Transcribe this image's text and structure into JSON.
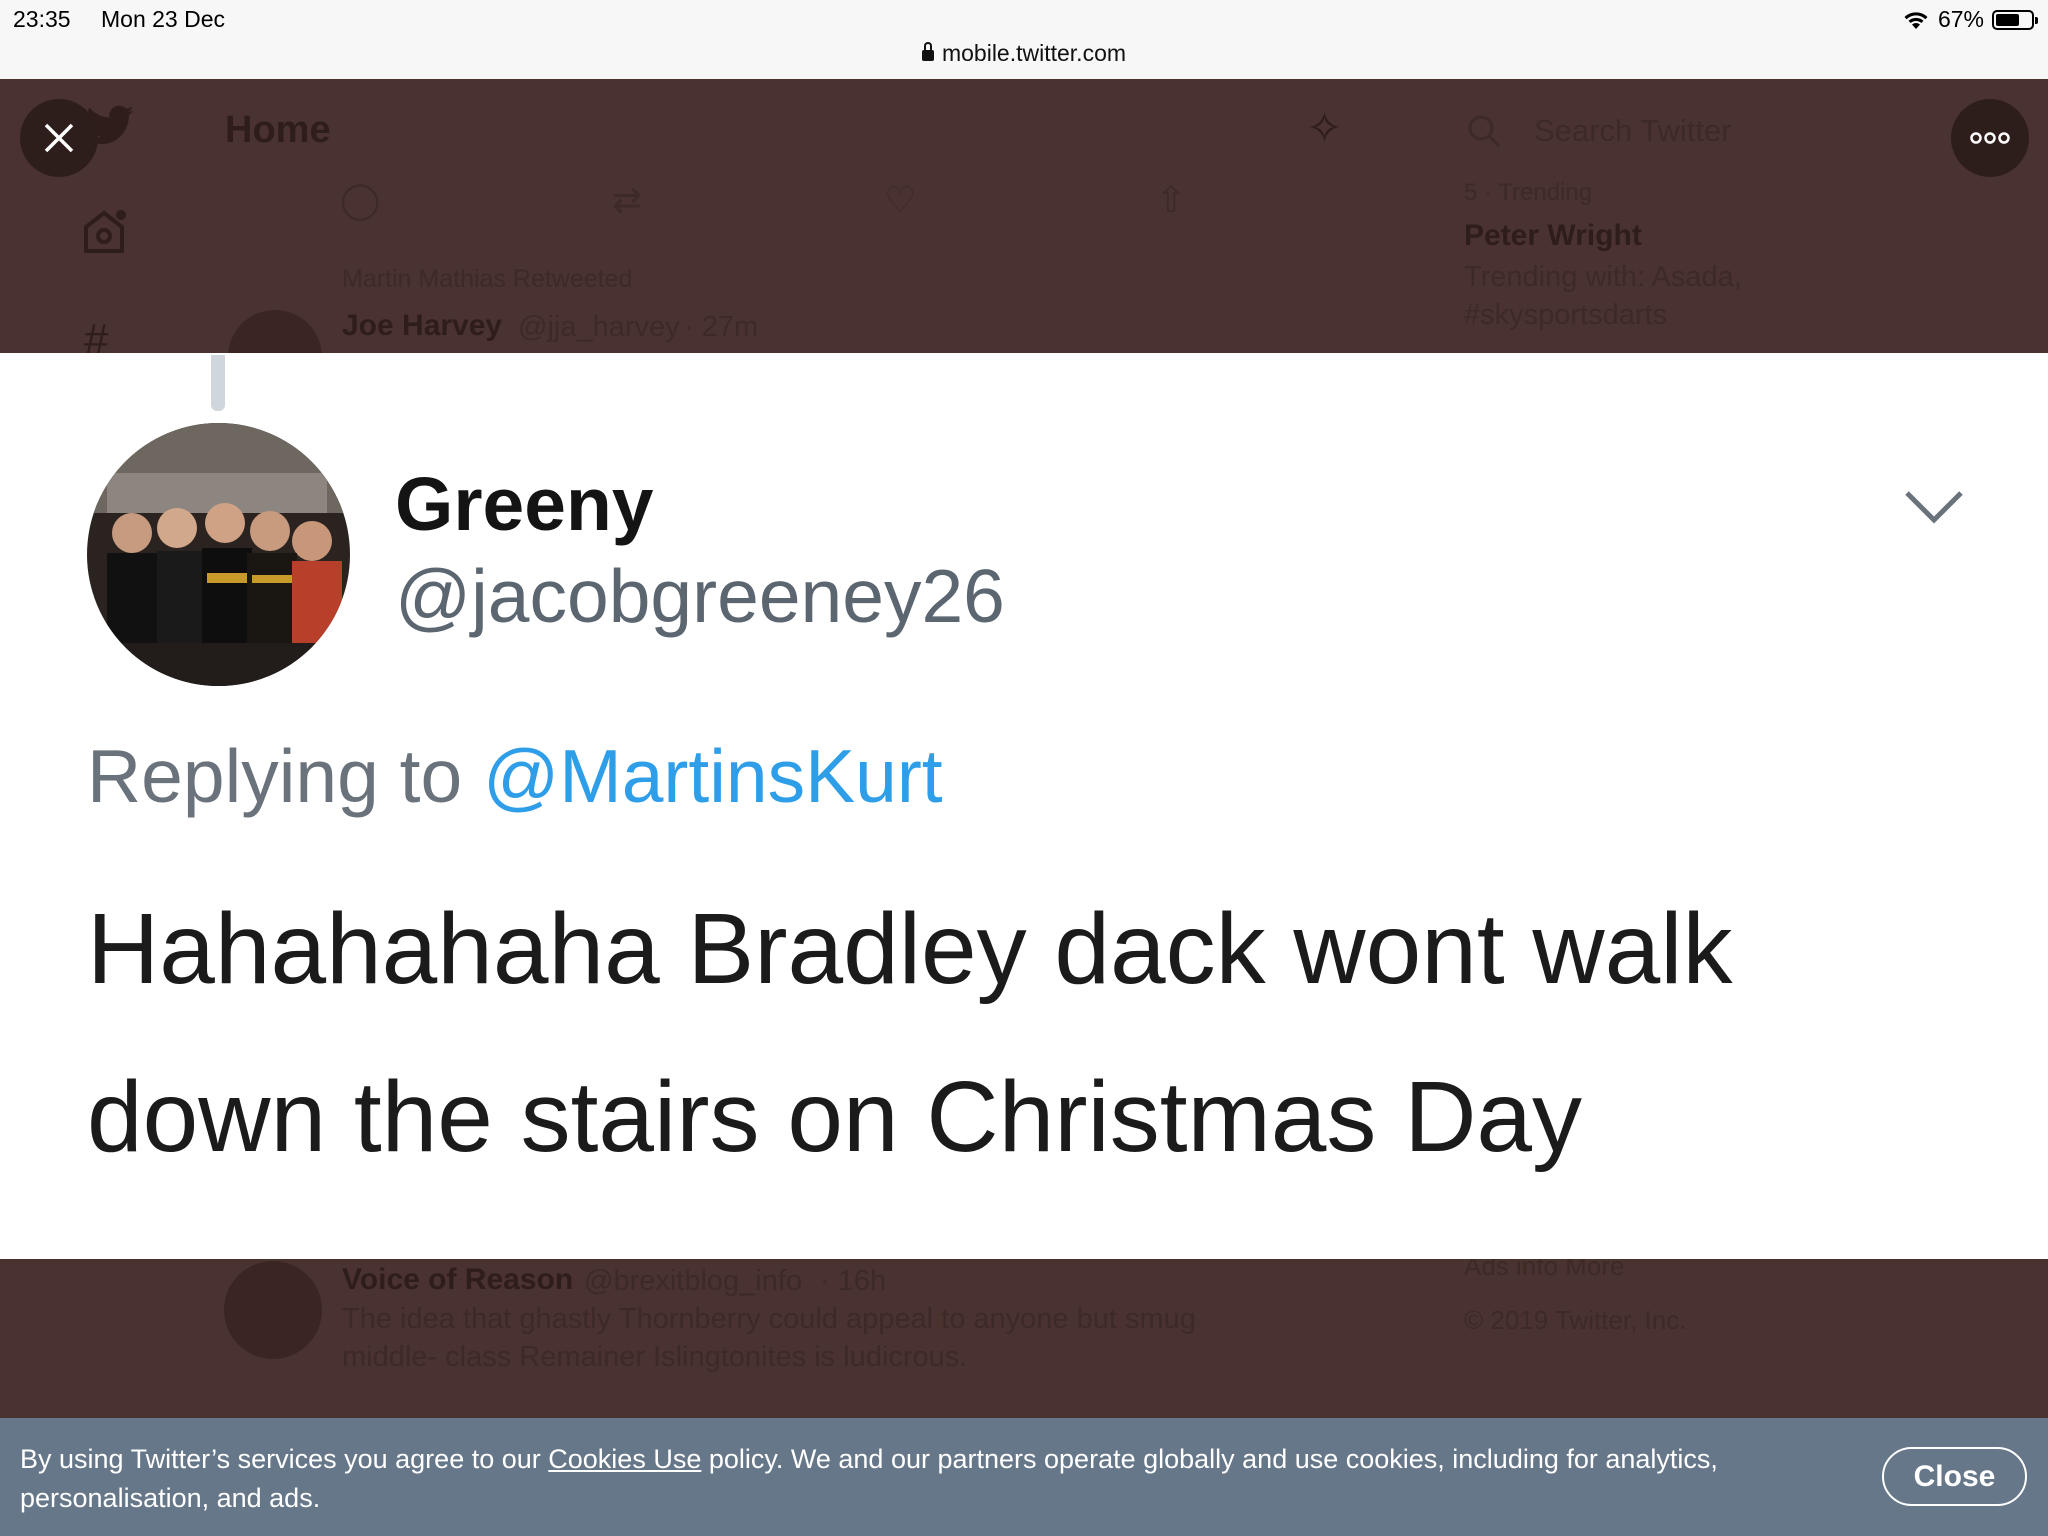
{
  "status_bar": {
    "time": "23:35",
    "date": "Mon 23 Dec",
    "url": "mobile.twitter.com",
    "battery": "67%"
  },
  "background": {
    "home_title": "Home",
    "search_placeholder": "Search Twitter",
    "retweeted_by": "Martin Mathias Retweeted",
    "tweet1": {
      "name": "Joe Harvey",
      "handle": "@jja_harvey",
      "time": "· 27m"
    },
    "trending": {
      "label": "5 · Trending",
      "topic": "Peter Wright",
      "with_line1": "Trending with: Asada,",
      "with_line2": "#skysportsdarts"
    },
    "tweet2": {
      "name": "Voice of Reason",
      "handle": "@brexitblog_info",
      "time": "· 16h",
      "text_line1": "The idea that ghastly Thornberry could appeal to anyone but smug",
      "text_line2": "middle- class Remainer Islingtonites is ludicrous."
    },
    "footer_links": "Ads info   More",
    "copyright": "© 2019 Twitter, Inc."
  },
  "tweet_image": {
    "display_name": "Greeny",
    "handle": "@jacobgreeney26",
    "replying_prefix": "Replying to",
    "replying_mention": "@MartinsKurt",
    "text": "Hahahahaha Bradley dack wont walk down the stairs on Christmas Day"
  },
  "cookie_banner": {
    "text_before": "By using Twitter’s services you agree to our",
    "link": "Cookies Use",
    "text_after": "policy. We and our partners operate globally and use cookies, including for analytics, personalisation, and ads.",
    "close_label": "Close"
  },
  "colors": {
    "overlay_bg": "#4a3230",
    "mention_blue": "#2f9ee8",
    "cookie_bg": "#66778a"
  }
}
